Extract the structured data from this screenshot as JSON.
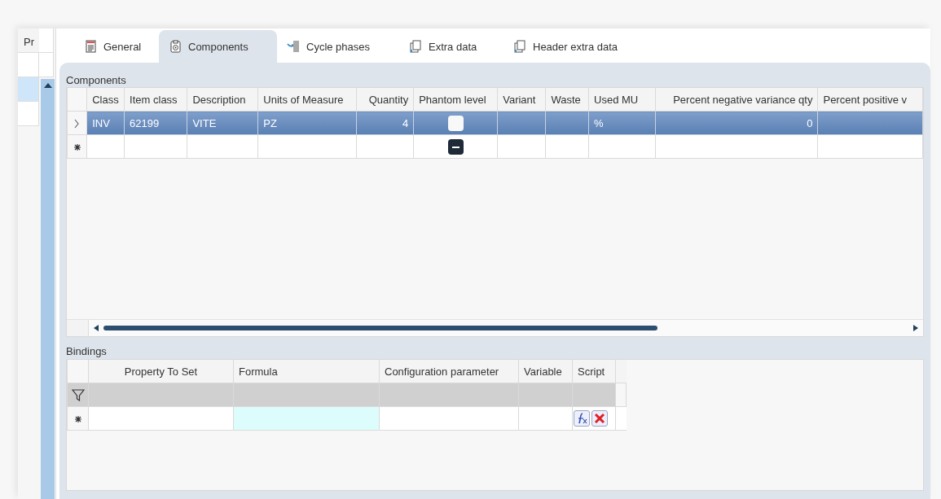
{
  "side_grid": {
    "header": "Pr",
    "rows": [
      {
        "selected": false
      },
      {
        "selected": true
      },
      {
        "selected": false
      }
    ]
  },
  "tabs": [
    {
      "label": "General",
      "selected": false
    },
    {
      "label": "Components",
      "selected": true
    },
    {
      "label": "Cycle phases",
      "selected": false
    },
    {
      "label": "Extra data",
      "selected": false
    },
    {
      "label": "Header extra data",
      "selected": false
    }
  ],
  "components": {
    "title": "Components",
    "columns": [
      {
        "label": "Class"
      },
      {
        "label": "Item class"
      },
      {
        "label": "Description"
      },
      {
        "label": "Units of Measure"
      },
      {
        "label": "Quantity",
        "numeric": true
      },
      {
        "label": "Phantom level"
      },
      {
        "label": "Variant"
      },
      {
        "label": "Waste"
      },
      {
        "label": "Used MU"
      },
      {
        "label": "Percent negative variance qty",
        "numeric": true
      },
      {
        "label": "Percent positive v"
      }
    ],
    "rows": [
      {
        "kind": "current",
        "selected": true,
        "cells": [
          "INV",
          "62199",
          "VITE",
          "PZ",
          "4",
          {
            "kind": "checkbox",
            "checked": false,
            "indeterminate": false
          },
          null,
          null,
          "%",
          "0",
          null
        ]
      },
      {
        "kind": "new",
        "selected": false,
        "cells": [
          null,
          null,
          null,
          null,
          null,
          {
            "kind": "checkbox",
            "indeterminate": true
          },
          null,
          null,
          null,
          null,
          null
        ]
      }
    ]
  },
  "bindings": {
    "title": "Bindings",
    "columns": [
      {
        "label": "Property To Set",
        "centered": true
      },
      {
        "label": "Formula"
      },
      {
        "label": "Configuration parameter"
      },
      {
        "label": "Variable"
      },
      {
        "label": "Script"
      }
    ],
    "filter_row": true,
    "rows": [
      {
        "kind": "new",
        "cells": [
          null,
          {
            "kind": "highlight"
          },
          null,
          null,
          {
            "kind": "script_buttons"
          }
        ]
      }
    ]
  }
}
